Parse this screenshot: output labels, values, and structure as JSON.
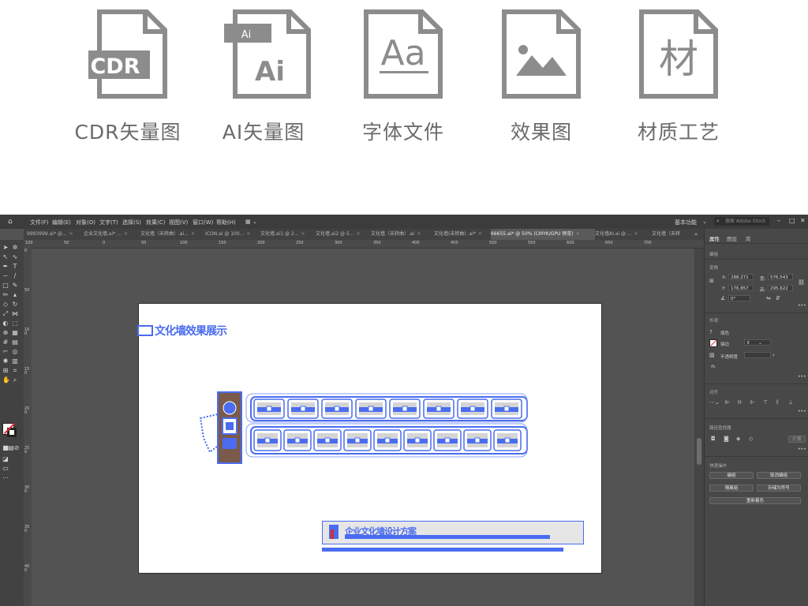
{
  "banner": {
    "items": [
      {
        "caption": "CDR矢量图",
        "badge": "CDR"
      },
      {
        "caption": "AI矢量图",
        "badge": "Ai",
        "badge_top": "Ai"
      },
      {
        "caption": "字体文件",
        "badge": "Aa"
      },
      {
        "caption": "效果图",
        "badge": "mountain-image"
      },
      {
        "caption": "材质工艺",
        "badge": "材"
      }
    ]
  },
  "menubar": {
    "items": [
      "文件(F)",
      "编辑(E)",
      "对象(O)",
      "文字(T)",
      "选择(S)",
      "效果(C)",
      "视图(V)",
      "窗口(W)",
      "帮助(H)"
    ],
    "workspace": "基本功能",
    "search_placeholder": "搜索 Adobe Stock"
  },
  "tabs": [
    {
      "label": "9993999.ai* @...",
      "active": false
    },
    {
      "label": "企业文化墙.ai* ...",
      "active": false
    },
    {
      "label": "文化墙（未转曲）.ai...",
      "active": false
    },
    {
      "label": "ICON.ai @ 100...",
      "active": false
    },
    {
      "label": "文化墙.ai1 @ 2...",
      "active": false
    },
    {
      "label": "文化墙.ai2 @ 5...",
      "active": false
    },
    {
      "label": "文化墙（未转曲）.ai",
      "active": false
    },
    {
      "label": "文化墙(未转曲) .ai*",
      "active": false
    },
    {
      "label": "66655.ai* @ 50% (CMYK/GPU 预览)",
      "active": true
    },
    {
      "label": "文化墙AI.ai @ ...",
      "active": false
    },
    {
      "label": "文化墙（未转",
      "active": false
    }
  ],
  "ruler_top": [
    "100",
    "50",
    "0",
    "50",
    "100",
    "150",
    "200",
    "250",
    "300",
    "350",
    "400",
    "450",
    "500",
    "550",
    "600",
    "650",
    "700"
  ],
  "ruler_left": [
    "0",
    "50",
    "100",
    "150",
    "200",
    "250",
    "300",
    "350",
    "400"
  ],
  "artboard": {
    "title_text": "文化墙效果展示",
    "bottom_text": "企业文化墙设计方案"
  },
  "panel": {
    "tabs": [
      "属性",
      "图层",
      "库"
    ],
    "section_edit": "编组",
    "section_transform": "变换",
    "x_label": "X:",
    "x_value": "288.271",
    "y_label": "Y:",
    "y_value": "176.857",
    "w_label": "宽:",
    "w_value": "576.543",
    "h_label": "高:",
    "h_value": "295.622",
    "angle_value": "0°",
    "section_appearance": "外观",
    "fill_label": "填色",
    "stroke_label": "描边",
    "opacity_label": "不透明度",
    "fx_label": "fx.",
    "section_align": "对齐",
    "section_pathfinder": "路径查找器",
    "expand_label": "扩展",
    "section_quick": "快速操作",
    "btn_edit_group": "编组",
    "btn_ungroup": "取消编组",
    "btn_isolate": "隔离组",
    "btn_save_symbol": "存储为符号",
    "btn_recolor": "重新着色"
  },
  "colors": {
    "selection": "#4a6cf0",
    "icon_gray": "#8c8c8c",
    "ui_dark": "#3c3c3c",
    "canvas": "#535353",
    "panel": "#484848"
  }
}
